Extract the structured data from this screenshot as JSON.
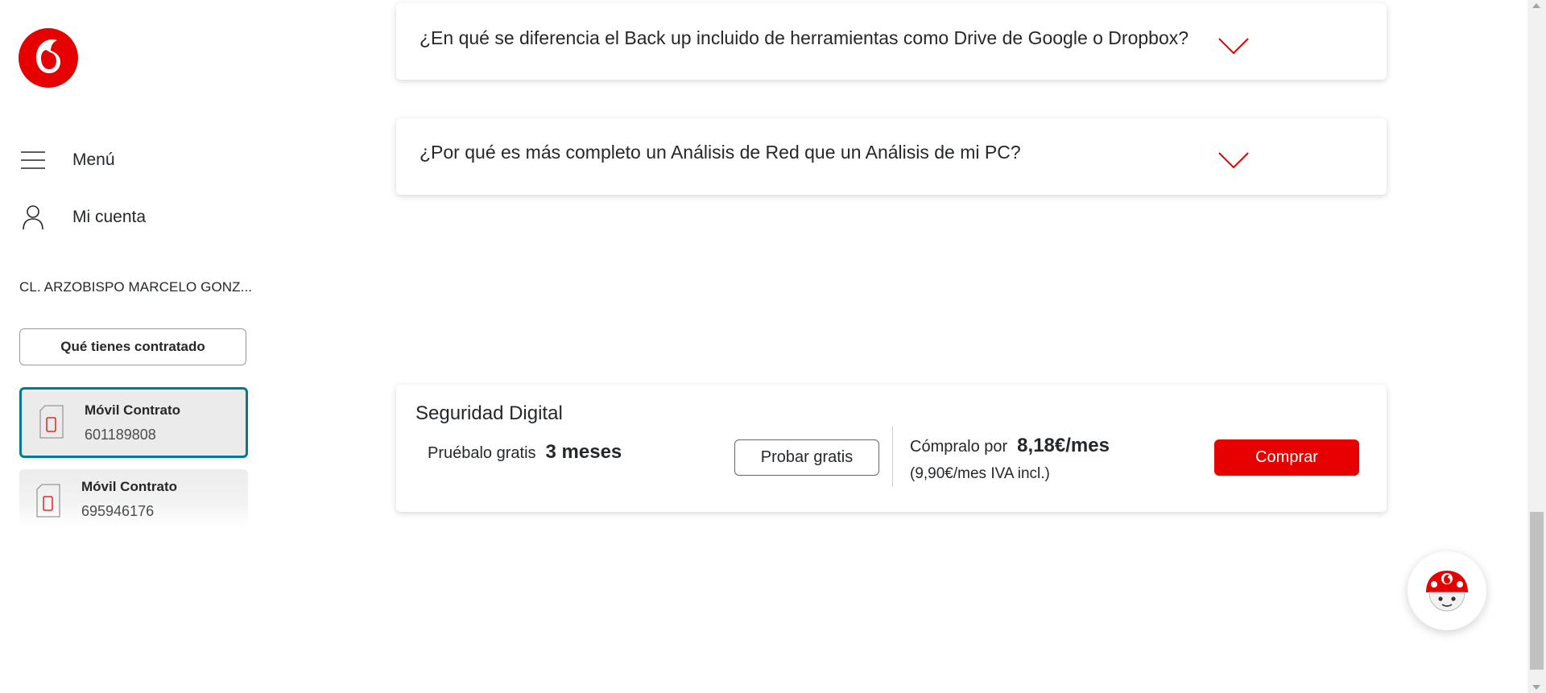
{
  "sidebar": {
    "logo": "vodafone-logo",
    "menu_label": "Menú",
    "account_label": "Mi cuenta",
    "address": "CL. ARZOBISPO MARCELO GONZ...",
    "contract_button": "Qué tienes contratado",
    "lines": [
      {
        "title": "Móvil Contrato",
        "number": "601189808",
        "selected": true
      },
      {
        "title": "Móvil Contrato",
        "number": "695946176",
        "selected": false
      }
    ]
  },
  "faq": [
    {
      "question": "¿En qué se diferencia el Back up incluido de herramientas como Drive de Google o Dropbox?",
      "icon": "chevron-down-icon"
    },
    {
      "question": "¿Por qué es más completo un Análisis de Red que un Análisis de mi PC?",
      "icon": "chevron-down-icon"
    }
  ],
  "offer": {
    "title": "Seguridad Digital",
    "trial_text": "Pruébalo gratis",
    "trial_duration": "3 meses",
    "try_button": "Probar gratis",
    "price_label": "Cómpralo por",
    "price": "8,18€/mes",
    "price_vat": "(9,90€/mes IVA incl.)",
    "buy_button": "Comprar"
  },
  "chat": {
    "icon": "chatbot-avatar-icon"
  },
  "colors": {
    "brand_red": "#e60000",
    "selected_border": "#007c92",
    "text": "#25282b"
  }
}
